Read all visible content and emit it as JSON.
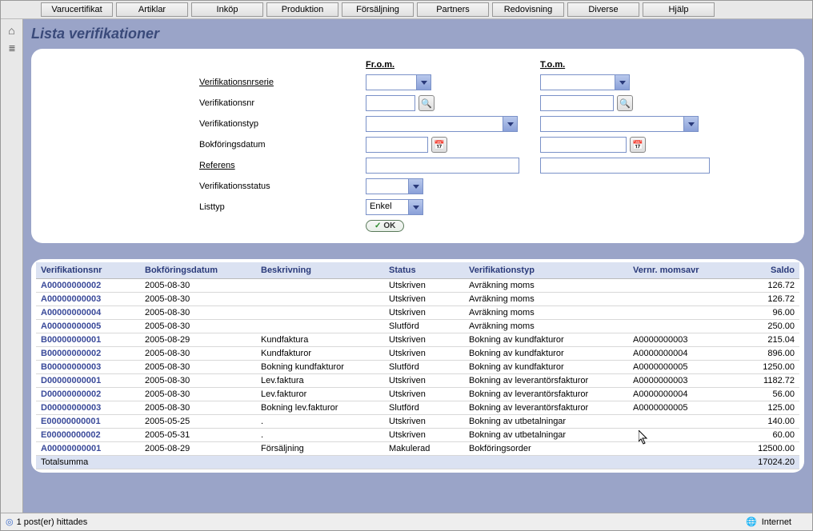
{
  "menu": [
    "Varucertifikat",
    "Artiklar",
    "Inköp",
    "Produktion",
    "Försäljning",
    "Partners",
    "Redovisning",
    "Diverse",
    "Hjälp"
  ],
  "title": "Lista verifikationer",
  "filter": {
    "hdr_from": "Fr.o.m.",
    "hdr_to": "T.o.m.",
    "labels": {
      "serie": "Verifikationsnrserie",
      "vnr": "Verifikationsnr",
      "vtyp": "Verifikationstyp",
      "bokdatum": "Bokföringsdatum",
      "referens": "Referens",
      "vstatus": "Verifikationsstatus",
      "listtyp": "Listtyp"
    },
    "listtyp_value": "Enkel",
    "ok": "OK"
  },
  "columns": [
    "Verifikationsnr",
    "Bokföringsdatum",
    "Beskrivning",
    "Status",
    "Verifikationstyp",
    "Vernr. momsavr",
    "Saldo"
  ],
  "rows": [
    {
      "vnr": "A00000000002",
      "date": "2005-08-30",
      "desc": "",
      "status": "Utskriven",
      "vtyp": "Avräkning moms",
      "vmoms": "",
      "saldo": "126.72"
    },
    {
      "vnr": "A00000000003",
      "date": "2005-08-30",
      "desc": "",
      "status": "Utskriven",
      "vtyp": "Avräkning moms",
      "vmoms": "",
      "saldo": "126.72"
    },
    {
      "vnr": "A00000000004",
      "date": "2005-08-30",
      "desc": "",
      "status": "Utskriven",
      "vtyp": "Avräkning moms",
      "vmoms": "",
      "saldo": "96.00"
    },
    {
      "vnr": "A00000000005",
      "date": "2005-08-30",
      "desc": "",
      "status": "Slutförd",
      "vtyp": "Avräkning moms",
      "vmoms": "",
      "saldo": "250.00"
    },
    {
      "vnr": "B00000000001",
      "date": "2005-08-29",
      "desc": "Kundfaktura",
      "status": "Utskriven",
      "vtyp": "Bokning av kundfakturor",
      "vmoms": "A0000000003",
      "saldo": "215.04"
    },
    {
      "vnr": "B00000000002",
      "date": "2005-08-30",
      "desc": "Kundfakturor",
      "status": "Utskriven",
      "vtyp": "Bokning av kundfakturor",
      "vmoms": "A0000000004",
      "saldo": "896.00"
    },
    {
      "vnr": "B00000000003",
      "date": "2005-08-30",
      "desc": "Bokning kundfakturor",
      "status": "Slutförd",
      "vtyp": "Bokning av kundfakturor",
      "vmoms": "A0000000005",
      "saldo": "1250.00"
    },
    {
      "vnr": "D00000000001",
      "date": "2005-08-30",
      "desc": "Lev.faktura",
      "status": "Utskriven",
      "vtyp": "Bokning av leverantörsfakturor",
      "vmoms": "A0000000003",
      "saldo": "1182.72"
    },
    {
      "vnr": "D00000000002",
      "date": "2005-08-30",
      "desc": "Lev.fakturor",
      "status": "Utskriven",
      "vtyp": "Bokning av leverantörsfakturor",
      "vmoms": "A0000000004",
      "saldo": "56.00"
    },
    {
      "vnr": "D00000000003",
      "date": "2005-08-30",
      "desc": "Bokning lev.fakturor",
      "status": "Slutförd",
      "vtyp": "Bokning av leverantörsfakturor",
      "vmoms": "A0000000005",
      "saldo": "125.00"
    },
    {
      "vnr": "E00000000001",
      "date": "2005-05-25",
      "desc": ".",
      "status": "Utskriven",
      "vtyp": "Bokning av utbetalningar",
      "vmoms": "",
      "saldo": "140.00"
    },
    {
      "vnr": "E00000000002",
      "date": "2005-05-31",
      "desc": ".",
      "status": "Utskriven",
      "vtyp": "Bokning av utbetalningar",
      "vmoms": "",
      "saldo": "60.00"
    },
    {
      "vnr": "A00000000001",
      "date": "2005-08-29",
      "desc": "Försäljning",
      "status": "Makulerad",
      "vtyp": "Bokföringsorder",
      "vmoms": "",
      "saldo": "12500.00"
    }
  ],
  "total": {
    "label": "Totalsumma",
    "saldo": "17024.20"
  },
  "status": {
    "left": "1 post(er) hittades",
    "zone": "Internet"
  }
}
